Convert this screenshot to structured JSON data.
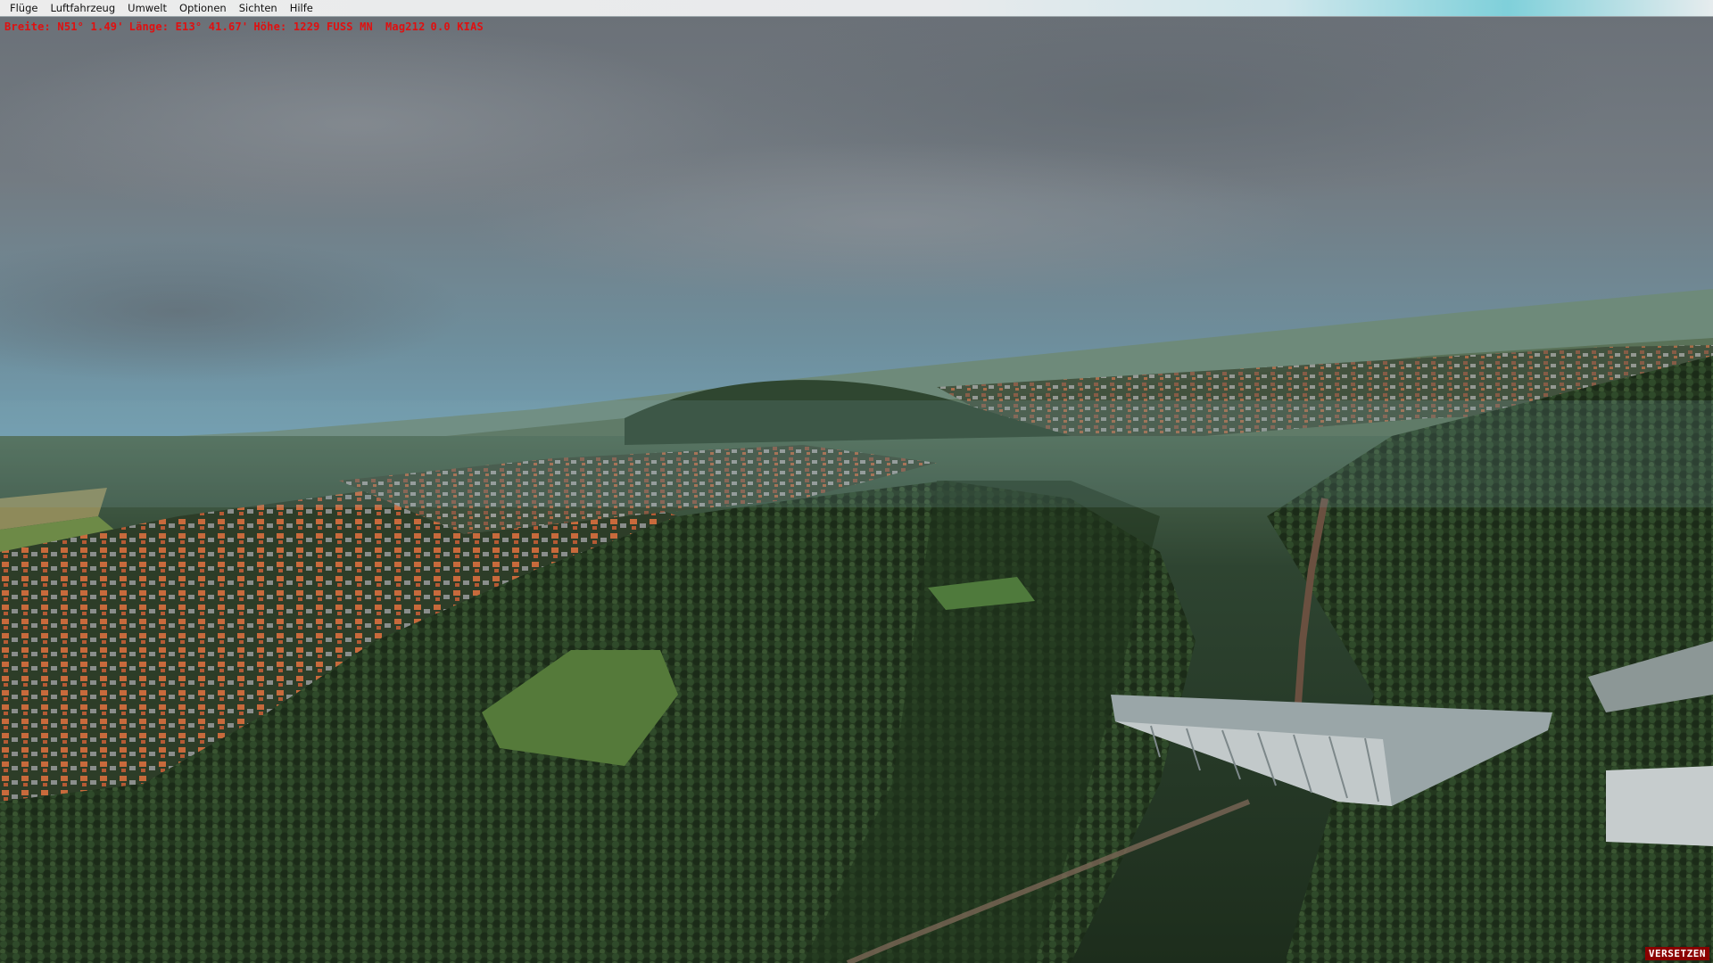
{
  "menu": {
    "items": [
      "Flüge",
      "Luftfahrzeug",
      "Umwelt",
      "Optionen",
      "Sichten",
      "Hilfe"
    ]
  },
  "status": {
    "lat": "Breite: N51° 1.49'",
    "lon": "Länge: E13° 41.67'",
    "alt": "Höhe: 1229 FUSS MN",
    "mag": "Mag212",
    "speed": "0.0 KIAS"
  },
  "slew_badge": "VERSETZEN",
  "colors": {
    "overlay_text": "#e01010",
    "badge_bg": "#8b0000",
    "sky_top": "#6c747c",
    "sky_horizon": "#6fa2b6",
    "forest": "#22351f"
  }
}
